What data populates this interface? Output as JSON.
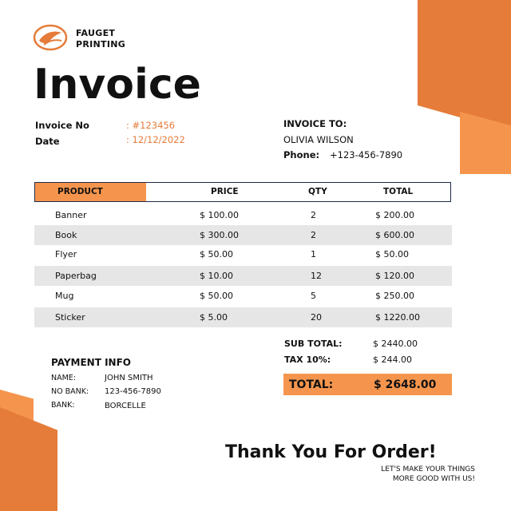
{
  "company": {
    "line1": "FAUGET",
    "line2": "PRINTING"
  },
  "title": "Invoice",
  "invoice": {
    "no_label": "Invoice No",
    "no_value": ": #123456",
    "date_label": "Date",
    "date_value": ": 12/12/2022"
  },
  "invoice_to": {
    "heading": "INVOICE TO:",
    "name": "OLIVIA WILSON",
    "phone_label": "Phone:",
    "phone": "+123-456-7890"
  },
  "table": {
    "headers": {
      "product": "PRODUCT",
      "price": "PRICE",
      "qty": "QTY",
      "total": "TOTAL"
    },
    "rows": [
      {
        "product": "Banner",
        "price": "$ 100.00",
        "qty": "2",
        "total": "$ 200.00"
      },
      {
        "product": "Book",
        "price": "$ 300.00",
        "qty": "2",
        "total": "$ 600.00"
      },
      {
        "product": "Flyer",
        "price": "$ 50.00",
        "qty": "1",
        "total": "$ 50.00"
      },
      {
        "product": "Paperbag",
        "price": "$ 10.00",
        "qty": "12",
        "total": "$ 120.00"
      },
      {
        "product": "Mug",
        "price": "$ 50.00",
        "qty": "5",
        "total": "$ 250.00"
      },
      {
        "product": "Sticker",
        "price": "$ 5.00",
        "qty": "20",
        "total": "$ 1220.00"
      }
    ]
  },
  "summary": {
    "subtotal_label": "SUB TOTAL:",
    "subtotal": "$ 2440.00",
    "tax_label": "TAX 10%:",
    "tax": "$ 244.00",
    "total_label": "TOTAL:",
    "total": "$ 2648.00"
  },
  "payment": {
    "heading": "PAYMENT INFO",
    "name_label": "NAME:",
    "name": "JOHN SMITH",
    "bank_no_label": "NO BANK:",
    "bank_no": "123-456-7890",
    "bank_label": "BANK:",
    "bank": "BORCELLE"
  },
  "footer": {
    "thanks": "Thank You For Order!",
    "slogan1": "LET'S MAKE YOUR THINGS",
    "slogan2": "MORE GOOD WITH US!"
  },
  "colors": {
    "accent": "#e57c3a",
    "accent_light": "#f5954d",
    "row_shade": "#e6e6e6",
    "header_border": "#1c2a4a"
  },
  "icons": {
    "logo": "leaf-circle-logo-icon"
  }
}
